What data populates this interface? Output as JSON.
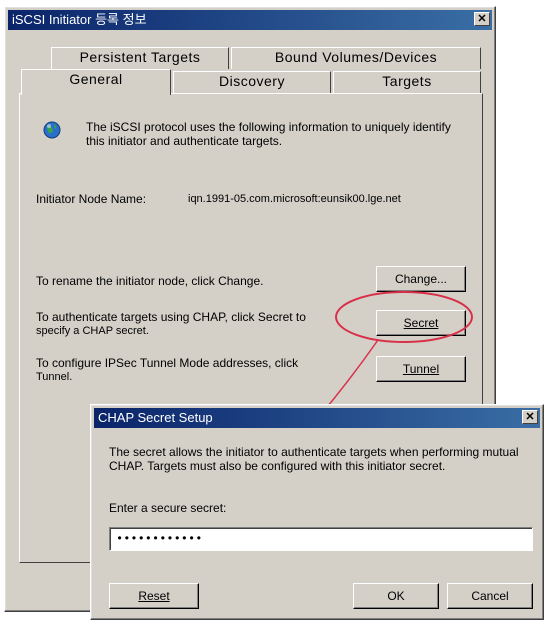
{
  "main_dialog": {
    "title": "iSCSI Initiator 등록 정보",
    "close_glyph": "✕",
    "tabs_back": [
      "Persistent Targets",
      "Bound Volumes/Devices"
    ],
    "tabs_front": [
      "General",
      "Discovery",
      "Targets"
    ],
    "intro_text": "The iSCSI protocol uses the following information to uniquely identify this initiator and authenticate targets.",
    "node_name_label": "Initiator Node Name:",
    "node_name_value": "iqn.1991-05.com.microsoft:eunsik00.lge.net",
    "rename_text": "To rename the initiator node, click Change.",
    "change_button": "Change...",
    "chap_text_1": "To authenticate targets using CHAP, click Secret to",
    "chap_text_2": "specify a CHAP secret.",
    "secret_button": "Secret",
    "ipsec_text_1": "To configure IPSec Tunnel Mode addresses, click",
    "ipsec_text_2": "Tunnel.",
    "tunnel_button": "Tunnel",
    "icon": "network-globe-icon"
  },
  "chap_dialog": {
    "title": "CHAP Secret Setup",
    "close_glyph": "✕",
    "description": "The secret allows the initiator to authenticate targets when performing mutual CHAP.  Targets must also be configured with this initiator secret.",
    "secret_label": "Enter a secure secret:",
    "secret_value": "••••••••••••",
    "reset_button": "Reset",
    "ok_button": "OK",
    "cancel_button": "Cancel"
  },
  "annotation": {
    "highlight_color": "#d9304a",
    "target": "Secret"
  }
}
